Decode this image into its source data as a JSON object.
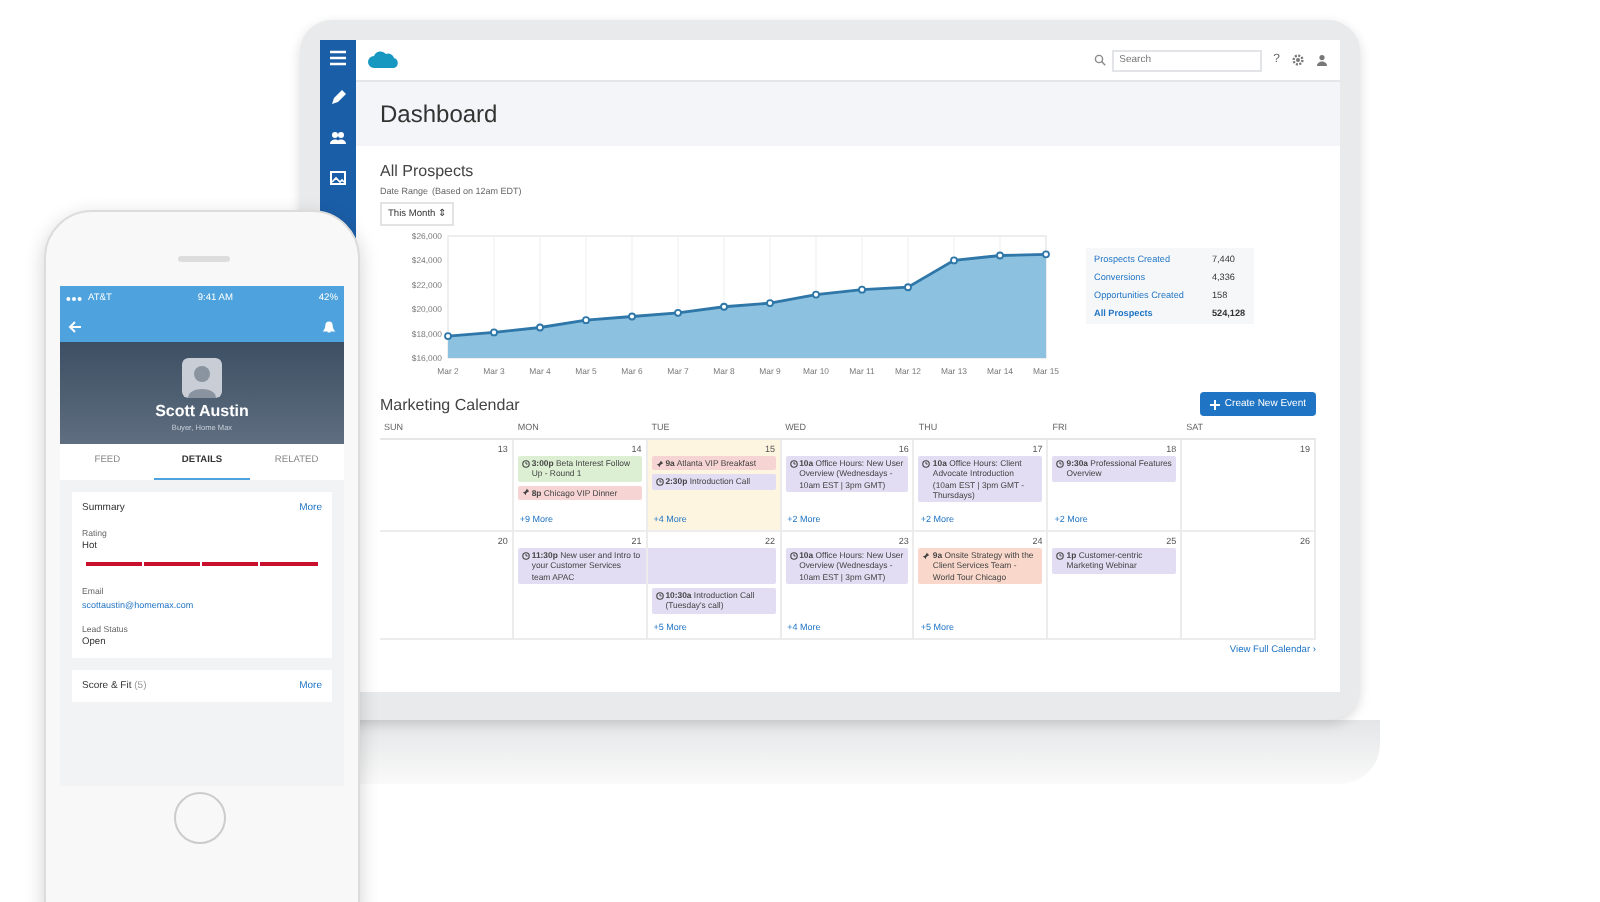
{
  "app_header": {
    "search": {
      "placeholder": "Search"
    },
    "icons": [
      "?"
    ]
  },
  "page": {
    "title": "Dashboard"
  },
  "prospects": {
    "title": "All Prospects",
    "date_range_label": "Date Range",
    "date_range_note": "(Based on 12am EDT)",
    "period": {
      "value": "This Month",
      "arrow": "⇕"
    },
    "chart_data": {
      "type": "area",
      "categories": [
        "Mar 2",
        "Mar 3",
        "Mar 4",
        "Mar 5",
        "Mar 6",
        "Mar 7",
        "Mar 8",
        "Mar 9",
        "Mar 10",
        "Mar 11",
        "Mar 12",
        "Mar 13",
        "Mar 14",
        "Mar 15"
      ],
      "grid": true,
      "series": [
        {
          "color": "#2e77a8",
          "values": [
            17800,
            18100,
            18500,
            19100,
            19400,
            19700,
            20200,
            20500,
            21200,
            21600,
            21800,
            24000,
            24400,
            24500
          ]
        }
      ],
      "ylim": [
        16000,
        26000
      ],
      "yticks": [
        {
          "value": 16000,
          "label": "$16,000"
        },
        {
          "value": 18000,
          "label": "$18,000"
        },
        {
          "value": 20000,
          "label": "$20,000"
        },
        {
          "value": 22000,
          "label": "$22,000"
        },
        {
          "value": 24000,
          "label": "$24,000"
        },
        {
          "value": 26000,
          "label": "$26,000"
        }
      ]
    },
    "summary": [
      {
        "label": "Prospects Created",
        "value": "7,440",
        "total": false
      },
      {
        "label": "Conversions",
        "value": "4,336",
        "total": false
      },
      {
        "label": "Opportunities Created",
        "value": "158",
        "total": false
      },
      {
        "label": "All Prospects",
        "value": "524,128",
        "total": true
      }
    ]
  },
  "calendar": {
    "title": "Marketing Calendar",
    "create_button": "Create New Event",
    "days_of_week": [
      "SUN",
      "MON",
      "TUE",
      "WED",
      "THU",
      "FRI",
      "SAT"
    ],
    "weeks": [
      {
        "days": [
          {
            "number": "13",
            "today": false
          },
          {
            "number": "14",
            "today": false,
            "events": [
              {
                "kind": "call",
                "time": "3:00p",
                "title": "Beta Interest Follow Up - Round 1",
                "color": "#dcefd3",
                "spans_next_day": false
              },
              {
                "kind": "event",
                "time": "8p",
                "title": "Chicago VIP Dinner",
                "color": "#f7d4d4",
                "spans_next_day": false
              }
            ],
            "more": "+9 More"
          },
          {
            "number": "15",
            "today": true,
            "events": [
              {
                "kind": "event",
                "time": "9a",
                "title": "Atlanta VIP Breakfast",
                "color": "#f7d4d4",
                "spans_next_day": false
              },
              {
                "kind": "call",
                "time": "2:30p",
                "title": "Introduction Call",
                "color": "#e2ddf3",
                "spans_next_day": false
              }
            ],
            "more": "+4 More"
          },
          {
            "number": "16",
            "today": false,
            "events": [
              {
                "kind": "call",
                "time": "10a",
                "title": "Office Hours: New User Overview (Wednesdays - 10am EST | 3pm GMT)",
                "color": "#e2ddf3",
                "spans_next_day": false
              }
            ],
            "more": "+2 More"
          },
          {
            "number": "17",
            "today": false,
            "events": [
              {
                "kind": "call",
                "time": "10a",
                "title": "Office Hours: Client Advocate Introduction (10am EST | 3pm GMT - Thursdays)",
                "color": "#e2ddf3",
                "spans_next_day": false
              }
            ],
            "more": "+2 More"
          },
          {
            "number": "18",
            "today": false,
            "events": [
              {
                "kind": "call",
                "time": "9:30a",
                "title": "Professional Features Overview",
                "color": "#e2ddf3",
                "spans_next_day": false
              }
            ],
            "more": "+2 More"
          },
          {
            "number": "19",
            "today": false
          }
        ]
      },
      {
        "days": [
          {
            "number": "20",
            "today": false
          },
          {
            "number": "21",
            "today": false,
            "events": [
              {
                "kind": "call",
                "time": "11:30p",
                "title": "New user and Intro to your Customer Services team APAC",
                "color": "#e2ddf3",
                "spans_next_day": true
              }
            ]
          },
          {
            "number": "22",
            "today": false,
            "events": [
              {
                "kind": "call",
                "time": "10:30a",
                "title": "Introduction Call (Tuesday's call)",
                "color": "#e2ddf3",
                "spans_next_day": false
              }
            ],
            "more": "+5 More"
          },
          {
            "number": "23",
            "today": false,
            "events": [
              {
                "kind": "call",
                "time": "10a",
                "title": "Office Hours: New User Overview (Wednesdays - 10am EST | 3pm GMT)",
                "color": "#e2ddf3",
                "spans_next_day": false
              }
            ],
            "more": "+4 More"
          },
          {
            "number": "24",
            "today": false,
            "events": [
              {
                "kind": "event",
                "time": "9a",
                "title": "Onsite Strategy with the Client Services Team - World Tour Chicago",
                "color": "#f9d8cb",
                "spans_next_day": false
              }
            ],
            "more": "+5 More"
          },
          {
            "number": "25",
            "today": false,
            "events": [
              {
                "kind": "call",
                "time": "1p",
                "title": "Customer-centric Marketing Webinar",
                "color": "#e2ddf3",
                "spans_next_day": false
              }
            ]
          },
          {
            "number": "26",
            "today": false
          }
        ]
      }
    ],
    "view_all": "View Full Calendar ›"
  },
  "phone": {
    "status_bar": {
      "carrier": "AT&T",
      "time": "9:41 AM",
      "battery": "42%"
    },
    "profile": {
      "name": "Scott Austin",
      "subtitle": "Buyer, Home Max"
    },
    "tabs": [
      {
        "label": "FEED",
        "selected": false
      },
      {
        "label": "DETAILS",
        "selected": true
      },
      {
        "label": "RELATED",
        "selected": false
      }
    ],
    "summary_card": {
      "title": "Summary",
      "more": "More",
      "rating_label": "Rating",
      "rating": "Hot",
      "rating_bar": {
        "level": 1
      },
      "email_label": "Email",
      "email": "scottaustin@homemax.com",
      "status_label": "Lead Status",
      "status": "Open"
    },
    "score_card": {
      "title": "Score & Fit",
      "count": "(5)",
      "more": "More"
    }
  }
}
